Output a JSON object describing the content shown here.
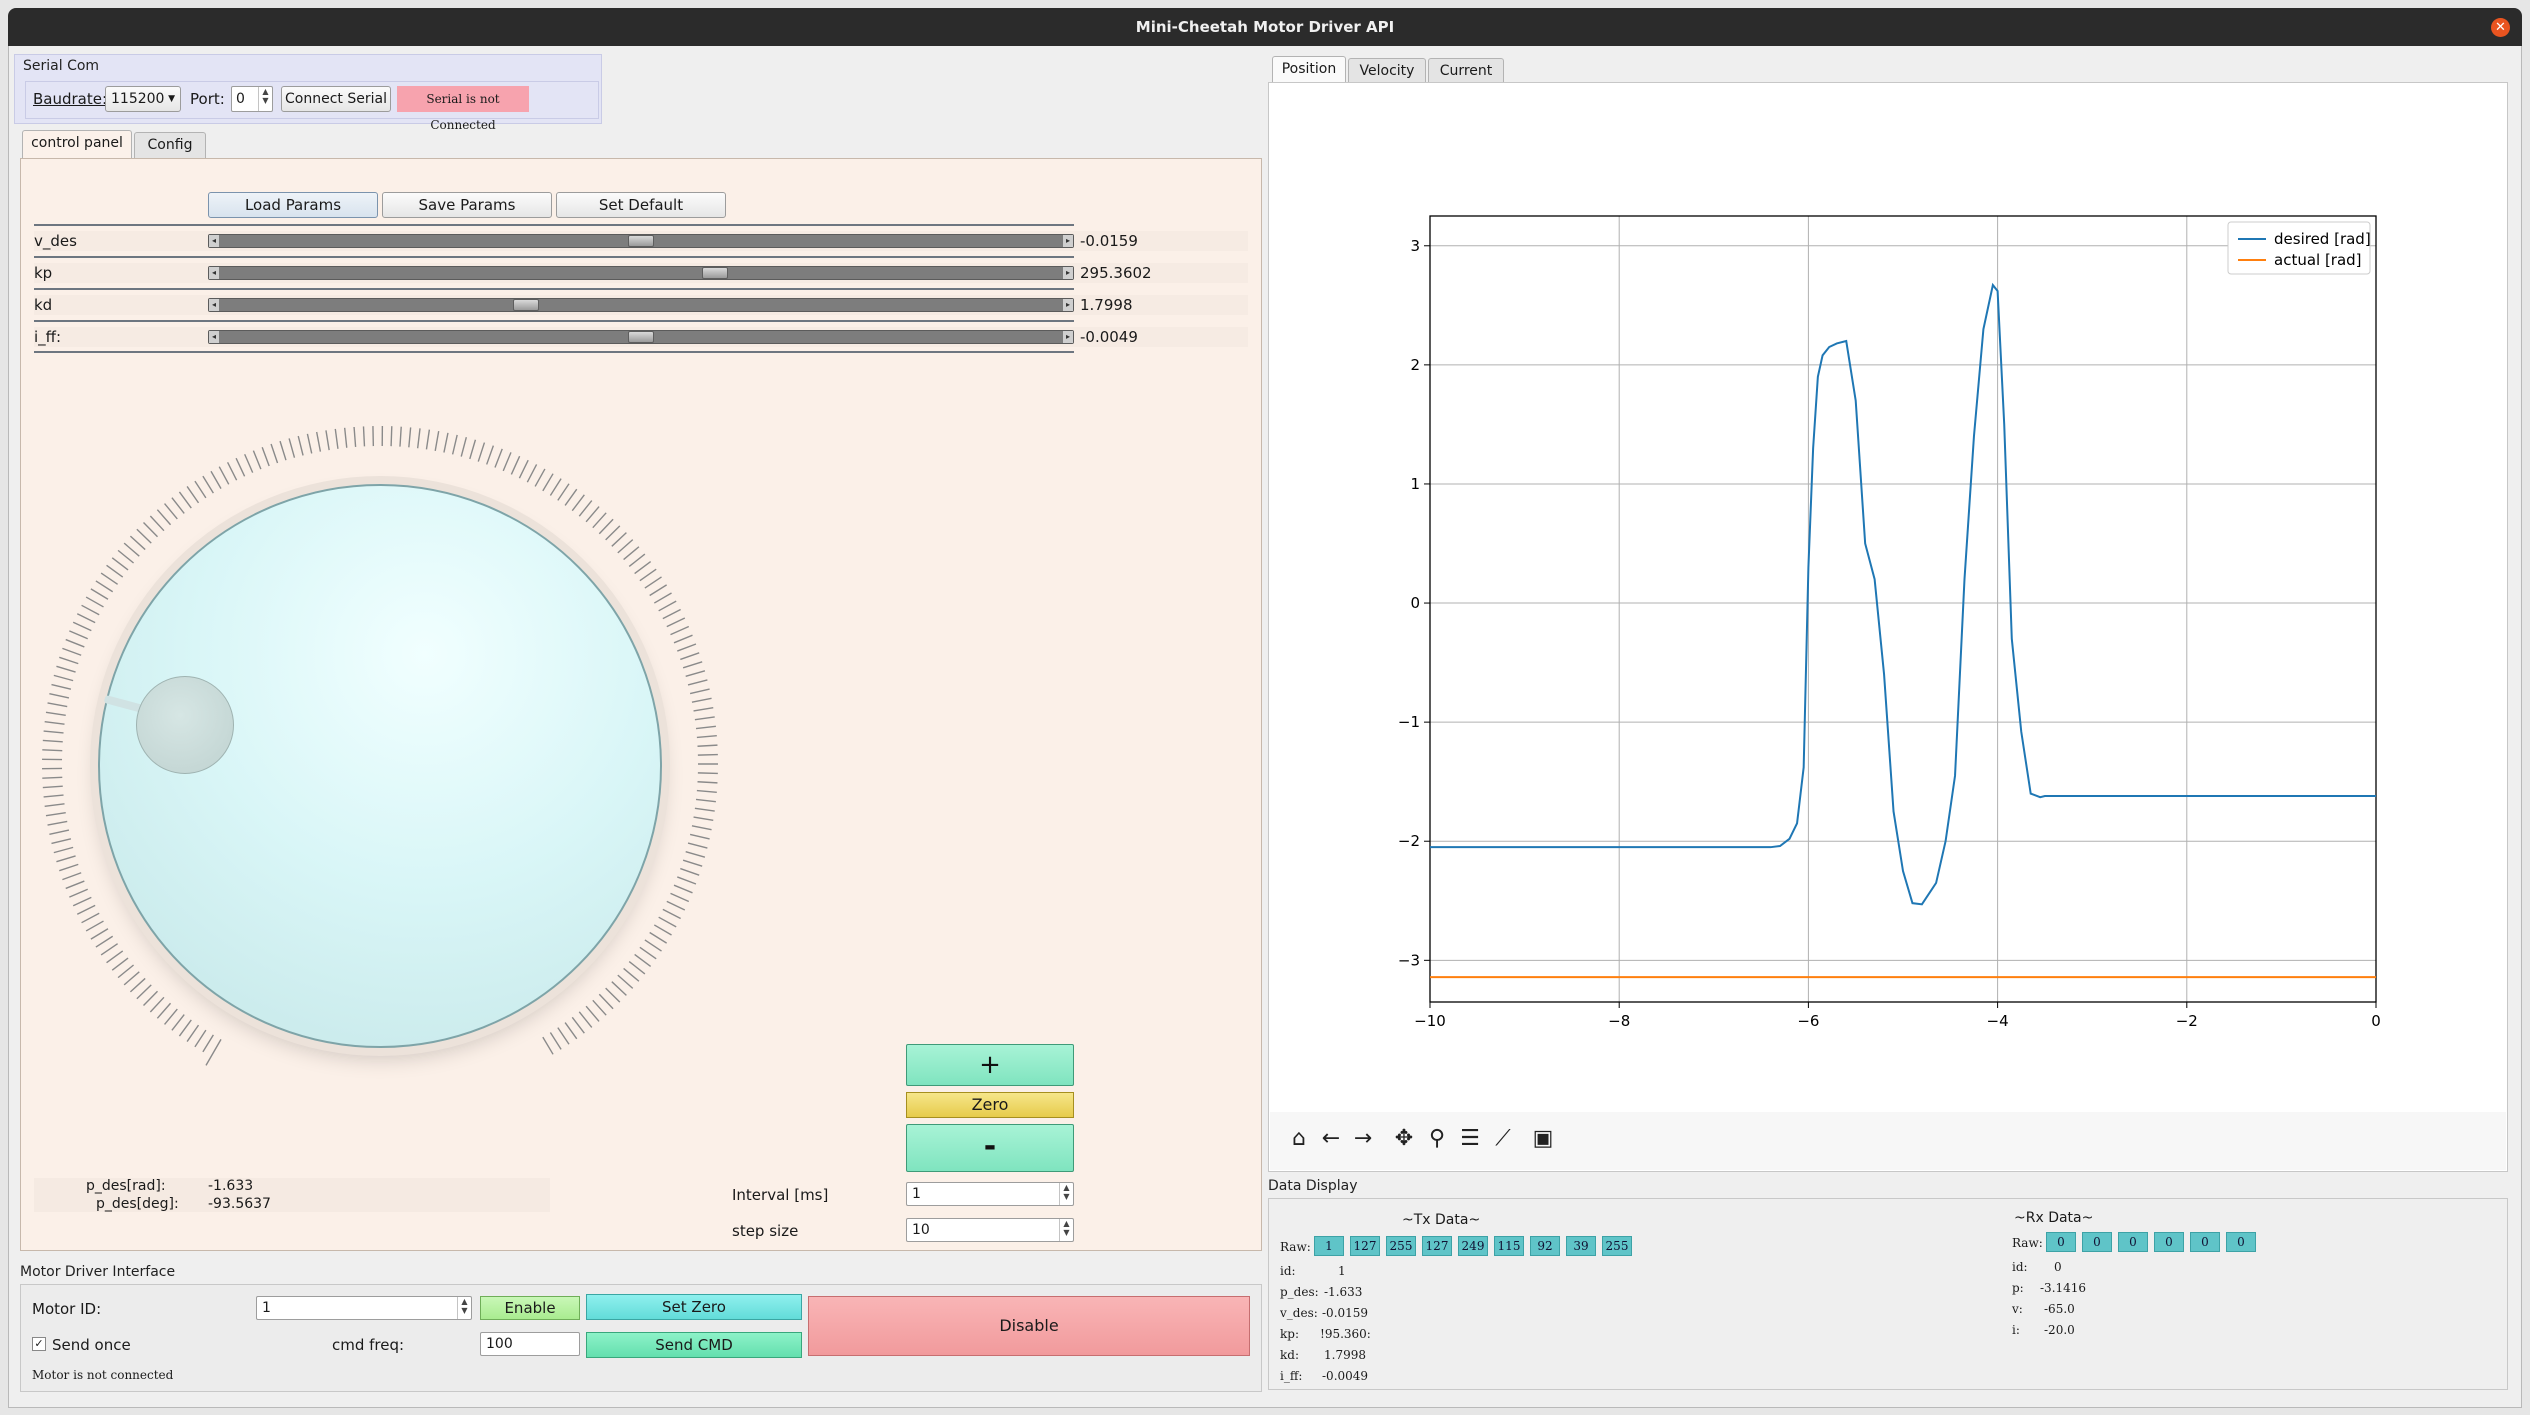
{
  "window": {
    "title": "Mini-Cheetah Motor Driver API"
  },
  "serial": {
    "group_title": "Serial Com",
    "baudrate_label": "Baudrate:",
    "baudrate_value": "115200",
    "port_label": "Port:",
    "port_value": "0",
    "connect_label": "Connect Serial",
    "status": "Serial is not Connected",
    "status_color": "#f7a3ae"
  },
  "left_tabs": [
    "control panel",
    "Config"
  ],
  "params_buttons": {
    "load": "Load Params",
    "save": "Save Params",
    "default": "Set Default"
  },
  "sliders": [
    {
      "label": "v_des",
      "value": "-0.0159",
      "fraction": 0.5
    },
    {
      "label": "kp",
      "value": "295.3602",
      "fraction": 0.59
    },
    {
      "label": "kd",
      "value": "1.7998",
      "fraction": 0.36
    },
    {
      "label": "i_ff:",
      "value": "-0.0049",
      "fraction": 0.5
    }
  ],
  "dial": {
    "value_rad": -1.633
  },
  "step_buttons": {
    "plus": "+",
    "zero": "Zero",
    "minus": "-"
  },
  "position_readout": {
    "rad_label": "p_des[rad]:",
    "rad_value": "-1.633",
    "deg_label": "p_des[deg]:",
    "deg_value": "-93.5637"
  },
  "interval": {
    "label": "Interval [ms]",
    "value": "1"
  },
  "step_size": {
    "label": "step size",
    "value": "10"
  },
  "motor_interface": {
    "group_title": "Motor Driver Interface",
    "motor_id_label": "Motor ID:",
    "motor_id_value": "1",
    "enable_label": "Enable",
    "set_zero_label": "Set Zero",
    "disable_label": "Disable",
    "send_once_label": "Send once",
    "send_once_checked": "✓",
    "cmd_freq_label": "cmd freq:",
    "cmd_freq_value": "100",
    "send_cmd_label": "Send CMD",
    "status": "Motor is not connected"
  },
  "right_tabs": [
    "Position",
    "Velocity",
    "Current"
  ],
  "toolbar_icons": [
    "home-icon",
    "back-arrow-icon",
    "forward-arrow-icon",
    "pan-icon",
    "zoom-icon",
    "configure-subplots-icon",
    "edit-axis-icon",
    "save-icon"
  ],
  "data_display": {
    "group_title": "Data Display",
    "tx_title": "~Tx Data~",
    "rx_title": "~Rx Data~",
    "raw_label": "Raw:",
    "tx_raw": [
      "1",
      "127",
      "255",
      "127",
      "249",
      "115",
      "92",
      "39",
      "255"
    ],
    "rx_raw": [
      "0",
      "0",
      "0",
      "0",
      "0",
      "0"
    ],
    "tx_fields": [
      {
        "label": "id:",
        "value": "1"
      },
      {
        "label": "p_des:",
        "value": "-1.633"
      },
      {
        "label": "v_des:",
        "value": "-0.0159"
      },
      {
        "label": "kp:",
        "value": "!95.360:"
      },
      {
        "label": "kd:",
        "value": "1.7998"
      },
      {
        "label": "i_ff:",
        "value": "-0.0049"
      }
    ],
    "rx_fields": [
      {
        "label": "id:",
        "value": "0"
      },
      {
        "label": "p:",
        "value": "-3.1416"
      },
      {
        "label": "v:",
        "value": "-65.0"
      },
      {
        "label": "i:",
        "value": "-20.0"
      }
    ]
  },
  "chart_data": {
    "type": "line",
    "xlim": [
      -10,
      0
    ],
    "ylim": [
      -3.35,
      3.25
    ],
    "xticks": [
      "−10",
      "−8",
      "−6",
      "−4",
      "−2",
      "0"
    ],
    "yticks": [
      "−3",
      "−2",
      "−1",
      "0",
      "1",
      "2",
      "3"
    ],
    "xtick_values": [
      -10,
      -8,
      -6,
      -4,
      -2,
      0
    ],
    "ytick_values": [
      -3,
      -2,
      -1,
      0,
      1,
      2,
      3
    ],
    "grid": true,
    "legend_position": "top-right",
    "series": [
      {
        "name": "desired [rad]",
        "color": "#1f77b4",
        "x": [
          -10,
          -6.4,
          -6.3,
          -6.2,
          -6.12,
          -6.05,
          -6.0,
          -5.95,
          -5.9,
          -5.85,
          -5.78,
          -5.7,
          -5.6,
          -5.5,
          -5.4,
          -5.3,
          -5.2,
          -5.1,
          -5.0,
          -4.9,
          -4.8,
          -4.65,
          -4.55,
          -4.45,
          -4.35,
          -4.25,
          -4.15,
          -4.05,
          -4.0,
          -3.93,
          -3.85,
          -3.75,
          -3.65,
          -3.55,
          -3.5,
          -3.4,
          0
        ],
        "y": [
          -2.05,
          -2.05,
          -2.04,
          -1.98,
          -1.85,
          -1.38,
          0.3,
          1.3,
          1.9,
          2.08,
          2.15,
          2.18,
          2.2,
          1.7,
          0.5,
          0.2,
          -0.6,
          -1.75,
          -2.25,
          -2.52,
          -2.53,
          -2.35,
          -2.0,
          -1.45,
          0.2,
          1.4,
          2.3,
          2.67,
          2.62,
          1.5,
          -0.3,
          -1.08,
          -1.6,
          -1.63,
          -1.62,
          -1.62,
          -1.62
        ]
      },
      {
        "name": "actual [rad]",
        "color": "#ff7f0e",
        "x": [
          -10,
          0
        ],
        "y": [
          -3.1416,
          -3.1416
        ]
      }
    ]
  }
}
